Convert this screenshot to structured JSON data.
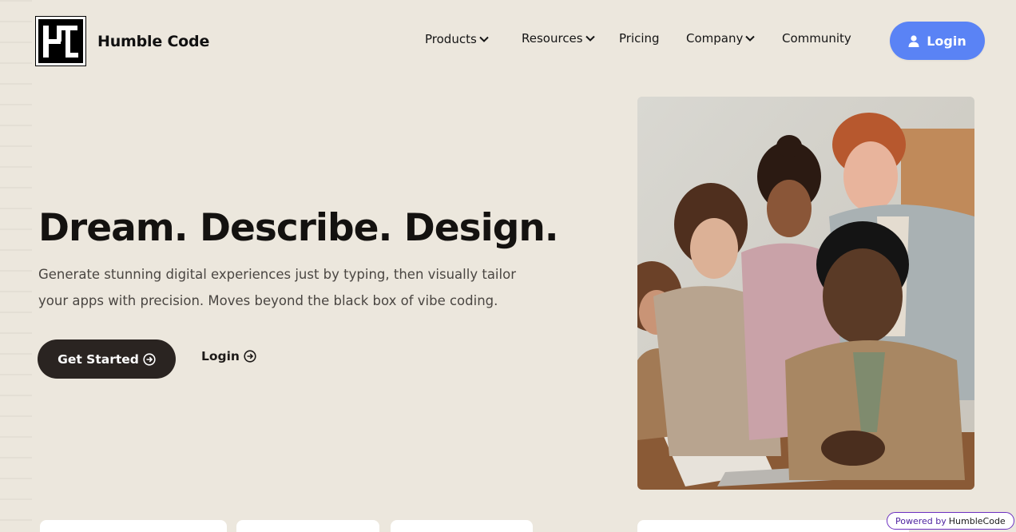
{
  "header": {
    "brand_name": "Humble Code",
    "nav": {
      "products": "Products",
      "resources": "Resources",
      "pricing": "Pricing",
      "company": "Company",
      "community": "Community"
    },
    "login_label": "Login"
  },
  "hero": {
    "title": "Dream. Describe. Design.",
    "subtitle": "Generate stunning digital experiences just by typing, then visually tailor your apps with precision. Moves beyond the black box of vibe coding.",
    "primary_button": "Get Started",
    "secondary_button": "Login"
  },
  "badge": {
    "powered_by": "Powered by",
    "brand": "HumbleCode"
  },
  "colors": {
    "background": "#ece7dd",
    "login_button": "#5a83f5",
    "primary_button": "#2a2421"
  }
}
